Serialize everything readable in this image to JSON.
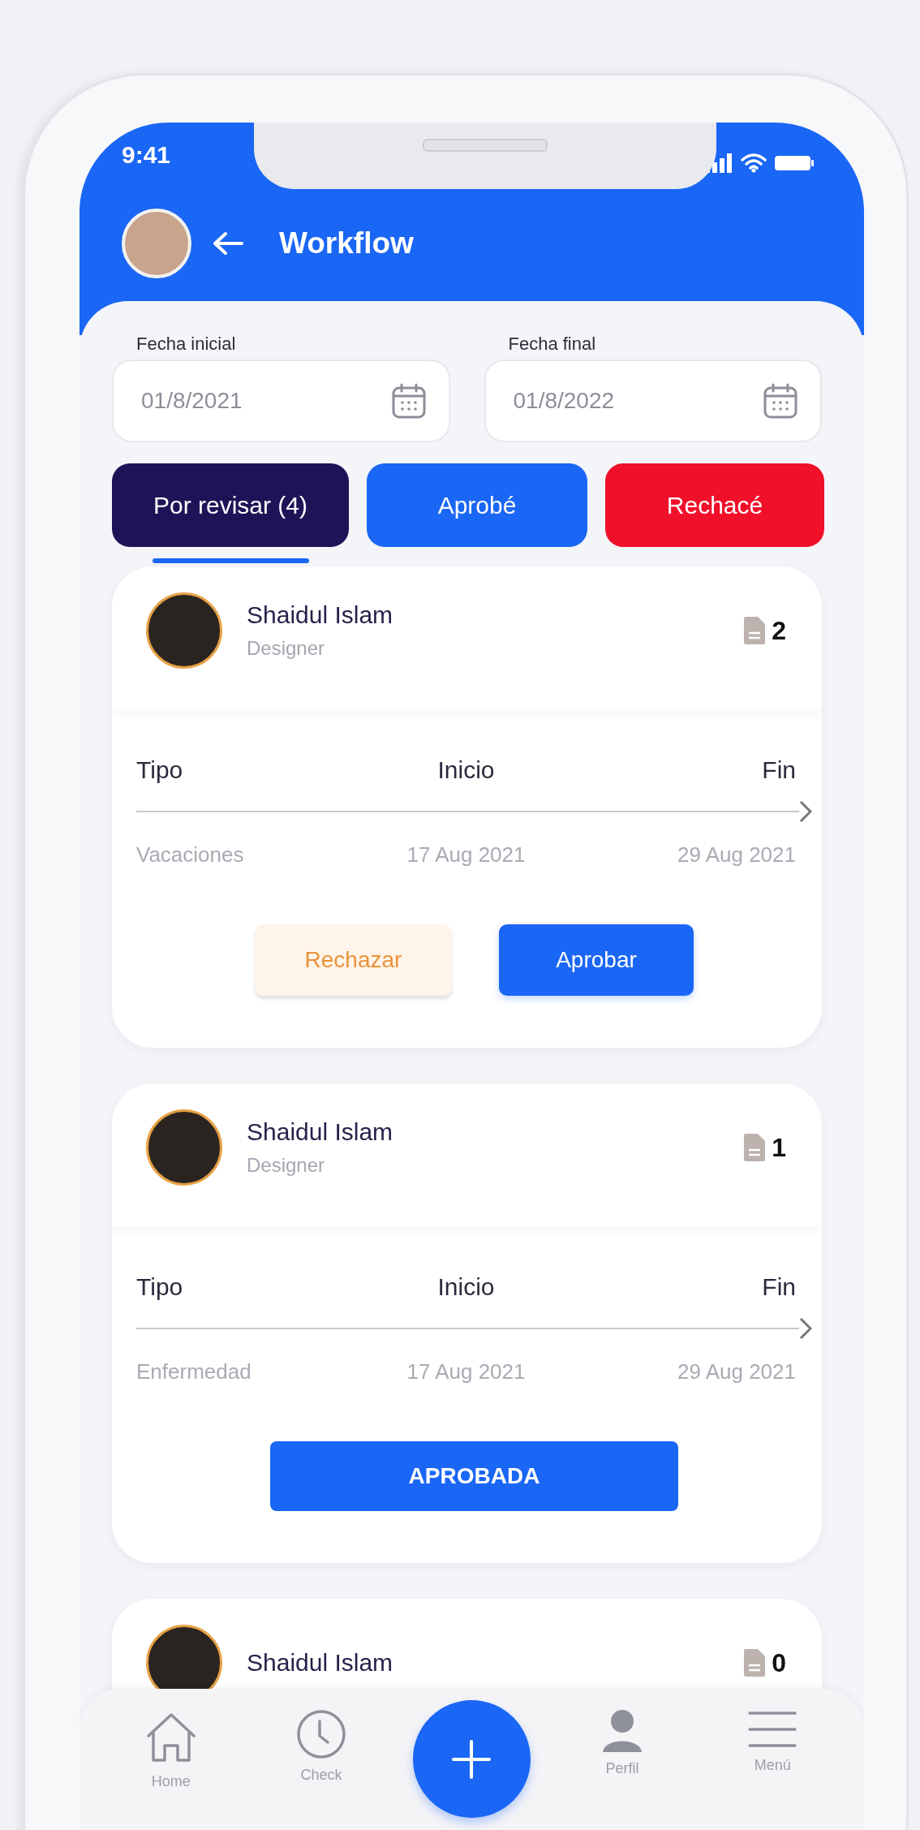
{
  "status_bar": {
    "time": "9:41"
  },
  "header": {
    "title": "Workflow"
  },
  "date_filters": [
    {
      "label": "Fecha inicial",
      "value": "01/8/2021"
    },
    {
      "label": "Fecha final",
      "value": "01/8/2022"
    }
  ],
  "tabs": [
    {
      "label": "Por revisar (4)",
      "kind": "pending",
      "selected": true
    },
    {
      "label": "Aprobé",
      "kind": "approved",
      "selected": false
    },
    {
      "label": "Rechacé",
      "kind": "rejected",
      "selected": false
    }
  ],
  "requests": [
    {
      "name": "Shaidul Islam",
      "role": "Designer",
      "documents": "2",
      "columns": [
        "Tipo",
        "Inicio",
        "Fin"
      ],
      "values": [
        "Vacaciones",
        "17 Aug 2021",
        "29 Aug 2021"
      ],
      "actions": [
        {
          "label": "Rechazar",
          "kind": "reject"
        },
        {
          "label": "Aprobar",
          "kind": "approve"
        }
      ]
    },
    {
      "name": "Shaidul Islam",
      "role": "Designer",
      "documents": "1",
      "columns": [
        "Tipo",
        "Inicio",
        "Fin"
      ],
      "values": [
        "Enfermedad",
        "17 Aug 2021",
        "29 Aug 2021"
      ],
      "actions": [
        {
          "label": "APROBADA",
          "kind": "status"
        }
      ]
    },
    {
      "name": "Shaidul Islam",
      "documents": "0"
    }
  ],
  "nav": [
    {
      "label": "Home",
      "kind": "home"
    },
    {
      "label": "Check",
      "kind": "clock"
    },
    {
      "kind": "add"
    },
    {
      "label": "Perfil",
      "kind": "profile"
    },
    {
      "label": "Menú",
      "kind": "menu"
    }
  ]
}
